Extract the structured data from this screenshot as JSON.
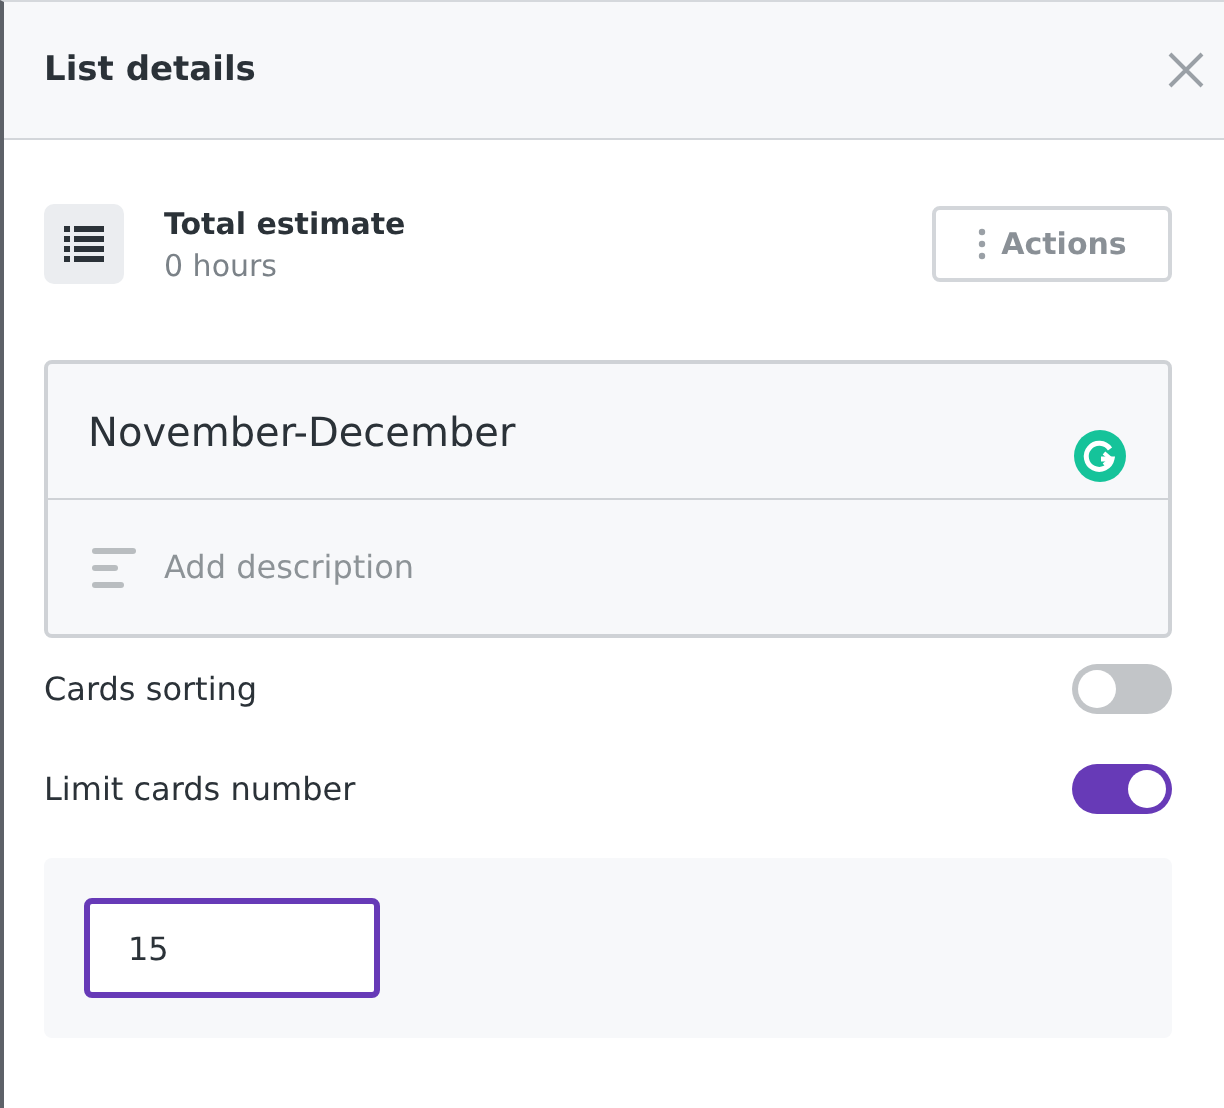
{
  "panel": {
    "title": "List details"
  },
  "estimate": {
    "label": "Total estimate",
    "value": "0 hours"
  },
  "actions_button": {
    "label": "Actions"
  },
  "list_name": {
    "value": "November-December"
  },
  "description": {
    "placeholder": "Add description"
  },
  "settings": [
    {
      "label": "Cards sorting",
      "on": false
    },
    {
      "label": "Limit cards number",
      "on": true
    }
  ],
  "limit_field": {
    "value": "15"
  }
}
